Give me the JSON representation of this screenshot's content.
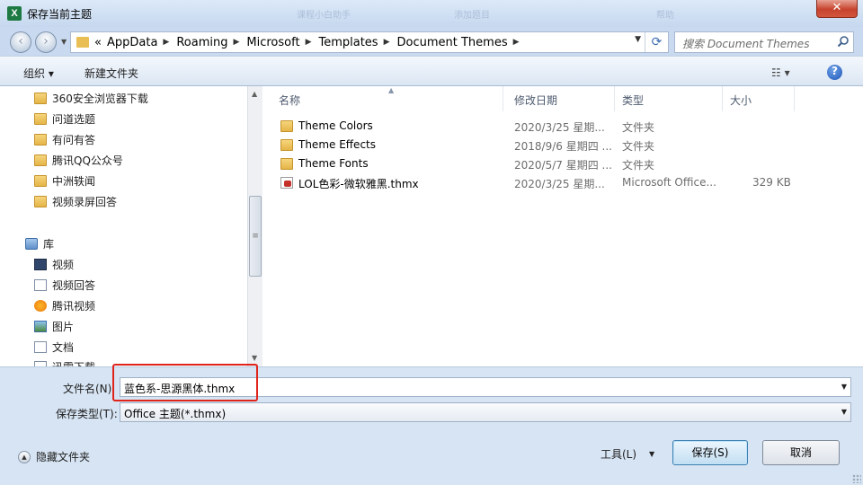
{
  "window": {
    "title": "保存当前主题",
    "app_icon_letter": "X",
    "close_glyph": "✕",
    "background_ghost_texts": [
      "课程小白助手",
      "添加题目",
      "帮助"
    ]
  },
  "nav": {
    "back_glyph": "‹",
    "forward_glyph": "›",
    "breadcrumb_prefix": "«",
    "breadcrumbs": [
      "AppData",
      "Roaming",
      "Microsoft",
      "Templates",
      "Document Themes"
    ],
    "search_placeholder": "搜索 Document Themes"
  },
  "toolbar": {
    "organize_label": "组织 ▾",
    "new_folder_label": "新建文件夹",
    "view_glyph": "☷ ▾",
    "help_glyph": "?"
  },
  "sidebar": {
    "folders": [
      "360安全浏览器下载",
      "问道选题",
      "有问有答",
      "腾讯QQ公众号",
      "中洲轶闻",
      "视频录屏回答"
    ],
    "library_label": "库",
    "library_items": [
      {
        "label": "视频",
        "icon": "video-library-icon"
      },
      {
        "label": "视频回答",
        "icon": "folder-icon"
      },
      {
        "label": "腾讯视频",
        "icon": "tencent-video-icon"
      },
      {
        "label": "图片",
        "icon": "pictures-library-icon"
      },
      {
        "label": "文档",
        "icon": "documents-library-icon"
      },
      {
        "label": "迅雷下载",
        "icon": "download-icon"
      }
    ],
    "scroll_grip": "≡",
    "scroll_up": "▲",
    "scroll_down": "▼"
  },
  "columns": {
    "name": "名称",
    "modified": "修改日期",
    "type": "类型",
    "size": "大小",
    "sort_glyph": "▲"
  },
  "files": [
    {
      "name": "Theme Colors",
      "modified": "2020/3/25 星期...",
      "type": "文件夹",
      "size": "",
      "icon": "folder-icon"
    },
    {
      "name": "Theme Effects",
      "modified": "2018/9/6 星期四 ...",
      "type": "文件夹",
      "size": "",
      "icon": "folder-icon"
    },
    {
      "name": "Theme Fonts",
      "modified": "2020/5/7 星期四 ...",
      "type": "文件夹",
      "size": "",
      "icon": "folder-icon"
    },
    {
      "name": "LOL色彩-微软雅黑.thmx",
      "modified": "2020/3/25 星期...",
      "type": "Microsoft Office...",
      "size": "329 KB",
      "icon": "thmx-file-icon"
    }
  ],
  "form": {
    "filename_label": "文件名(N):",
    "filename_value": "蓝色系-思源黑体.thmx",
    "filetype_label": "保存类型(T):",
    "filetype_value": "Office 主题(*.thmx)",
    "dropdown_glyph": "▼"
  },
  "footer": {
    "hide_folders_label": "隐藏文件夹",
    "hide_glyph": "▲",
    "tools_label": "工具(L)",
    "tools_dropdown": "▼",
    "save_label": "保存(S)",
    "cancel_label": "取消"
  },
  "colors": {
    "accent_highlight": "#e0241b",
    "window_frame": "#c9daf0",
    "close_button": "#c7432e"
  }
}
